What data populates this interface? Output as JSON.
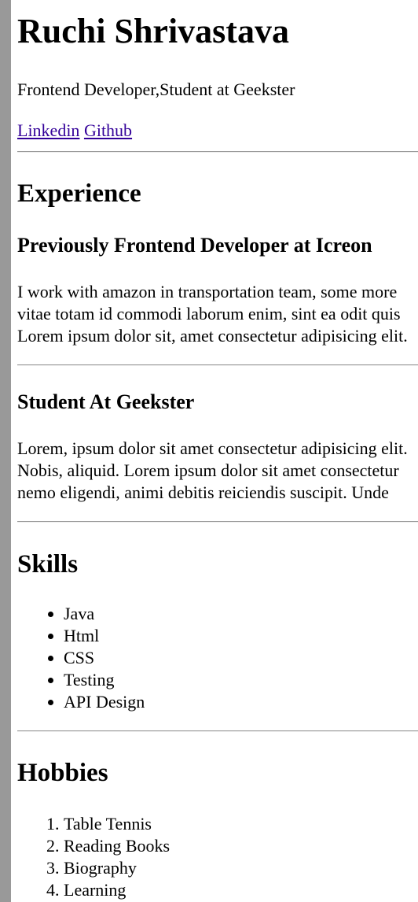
{
  "header": {
    "name": "Ruchi Shrivastava",
    "tagline": "Frontend Developer,Student at Geekster",
    "links": [
      {
        "label": "Linkedin"
      },
      {
        "label": "Github"
      }
    ]
  },
  "experience": {
    "heading": "Experience",
    "jobs": [
      {
        "title": "Previously Frontend Developer at Icreon",
        "lines": [
          "I work with amazon in transportation team, some more",
          "vitae totam id commodi laborum enim, sint ea odit quis",
          "Lorem ipsum dolor sit, amet consectetur adipisicing elit."
        ]
      },
      {
        "title": "Student At Geekster",
        "lines": [
          "Lorem, ipsum dolor sit amet consectetur adipisicing elit.",
          "Nobis, aliquid. Lorem ipsum dolor sit amet consectetur",
          "nemo eligendi, animi debitis reiciendis suscipit. Unde"
        ]
      }
    ]
  },
  "skills": {
    "heading": "Skills",
    "items": [
      "Java",
      "Html",
      "CSS",
      "Testing",
      "API Design"
    ]
  },
  "hobbies": {
    "heading": "Hobbies",
    "items": [
      "Table Tennis",
      "Reading Books",
      "Biography",
      "Learning"
    ]
  }
}
